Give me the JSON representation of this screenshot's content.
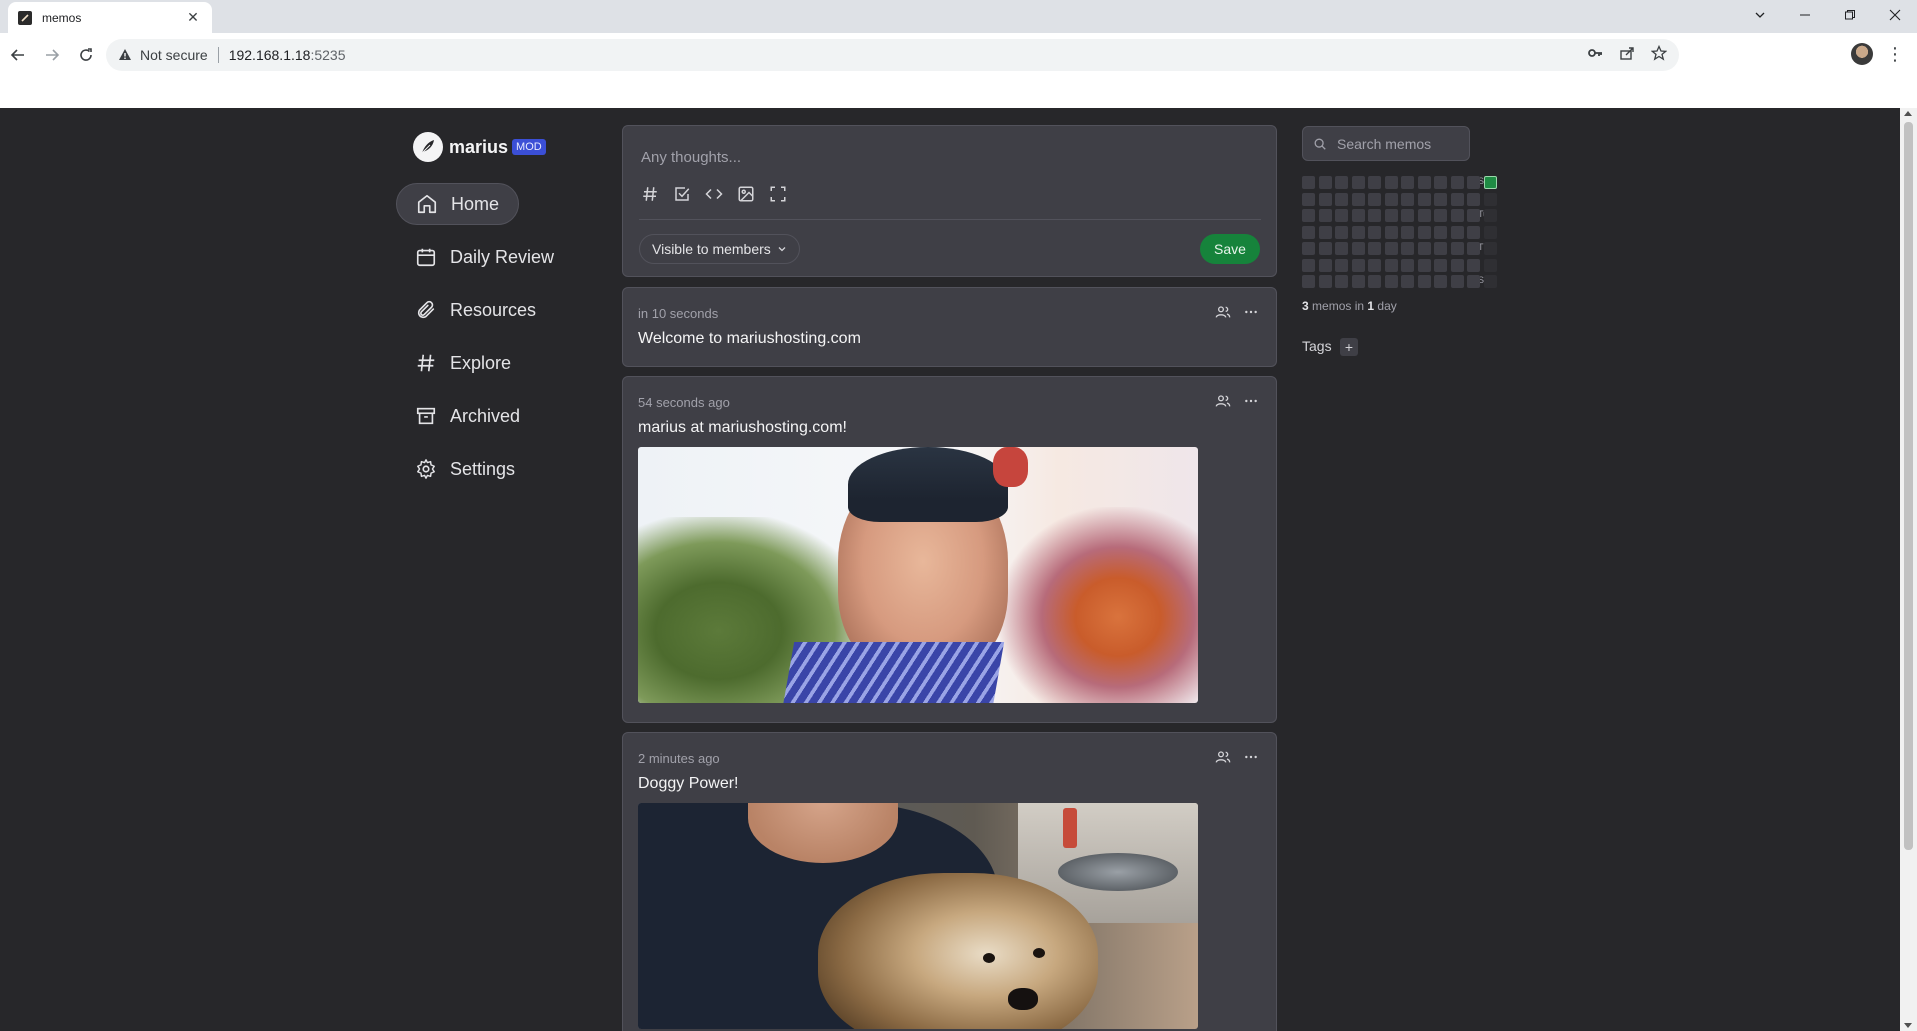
{
  "browser": {
    "tab_title": "memos",
    "security_text": "Not secure",
    "url_host": "192.168.1.18",
    "url_port": ":5235"
  },
  "sidebar": {
    "username": "marius",
    "role_badge": "MOD",
    "items": [
      {
        "label": "Home",
        "icon": "home-icon",
        "active": true
      },
      {
        "label": "Daily Review",
        "icon": "calendar-icon"
      },
      {
        "label": "Resources",
        "icon": "paperclip-icon"
      },
      {
        "label": "Explore",
        "icon": "hash-icon"
      },
      {
        "label": "Archived",
        "icon": "archive-icon"
      },
      {
        "label": "Settings",
        "icon": "gear-icon"
      }
    ]
  },
  "editor": {
    "placeholder": "Any thoughts...",
    "visibility": "Visible to members",
    "save_label": "Save"
  },
  "memos": [
    {
      "time": "in 10 seconds",
      "text": "Welcome to mariushosting.com"
    },
    {
      "time": "54 seconds ago",
      "text": "marius at mariushosting.com!"
    },
    {
      "time": "2 minutes ago",
      "text": "Doggy Power!"
    }
  ],
  "right_panel": {
    "search_placeholder": "Search memos",
    "day_labels": [
      "Sun",
      "Tue",
      "Thu",
      "Sat"
    ],
    "stats_count": "3",
    "stats_mid": " memos in ",
    "stats_days": "1",
    "stats_tail": " day",
    "tags_title": "Tags",
    "tags_add": "+"
  },
  "colors": {
    "page_bg": "#27272a",
    "card_bg": "#3f3f46",
    "accent_green": "#16833b",
    "badge_blue": "#3b4fd6"
  }
}
